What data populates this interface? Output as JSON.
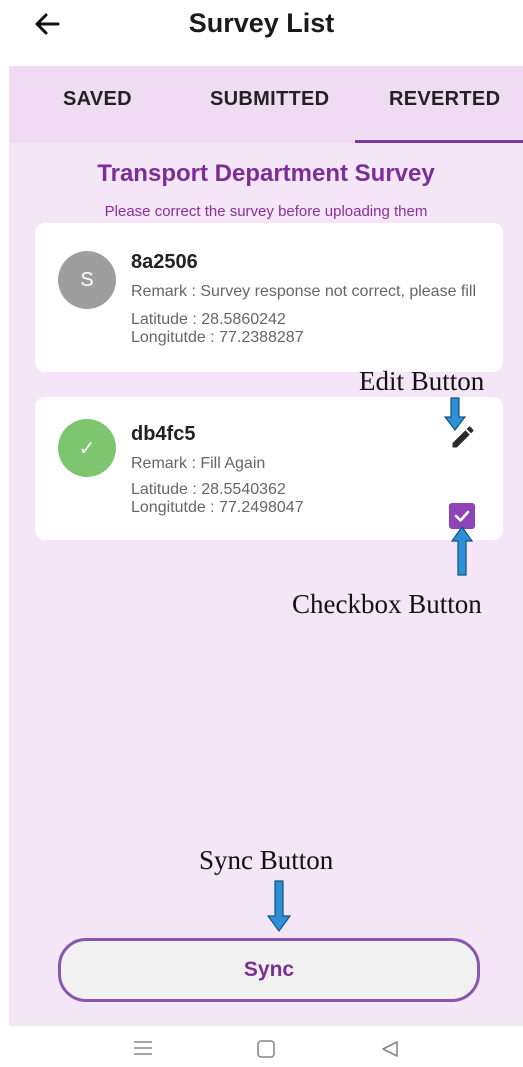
{
  "header": {
    "title": "Survey List",
    "back_icon": "arrow-left-icon"
  },
  "tabs": [
    {
      "label": "SAVED",
      "active": false
    },
    {
      "label": "SUBMITTED",
      "active": false
    },
    {
      "label": "REVERTED",
      "active": true
    }
  ],
  "survey": {
    "title": "Transport Department Survey",
    "hint": "Please correct the survey before uploading them"
  },
  "cards": [
    {
      "avatar": "S",
      "id": "8a2506",
      "remark": "Remark : Survey response not correct, please fill",
      "latitude": "Latitude : 28.5860242",
      "longitude": "Longitutde : 77.2388287"
    },
    {
      "avatar": "✓",
      "id": "db4fc5",
      "remark": "Remark : Fill Again",
      "latitude": "Latitude : 28.5540362",
      "longitude": "Longitutde : 77.2498047",
      "edit_icon": "pencil-icon",
      "checked": true
    }
  ],
  "annotations": {
    "edit": "Edit Button",
    "checkbox": "Checkbox Button",
    "sync": "Sync Button"
  },
  "sync_button": {
    "label": "Sync"
  },
  "navbar": {
    "icons": [
      "menu-icon",
      "home-square-icon",
      "back-triangle-icon"
    ]
  },
  "colors": {
    "accent": "#7a2e96",
    "tab_bar": "#efdcf2",
    "content_bg": "#f4e6f6",
    "checkbox": "#8d44b8",
    "avatar_grey": "#9e9e9e",
    "avatar_green": "#7dc56f",
    "annotation_arrow": "#2e8fd6"
  }
}
